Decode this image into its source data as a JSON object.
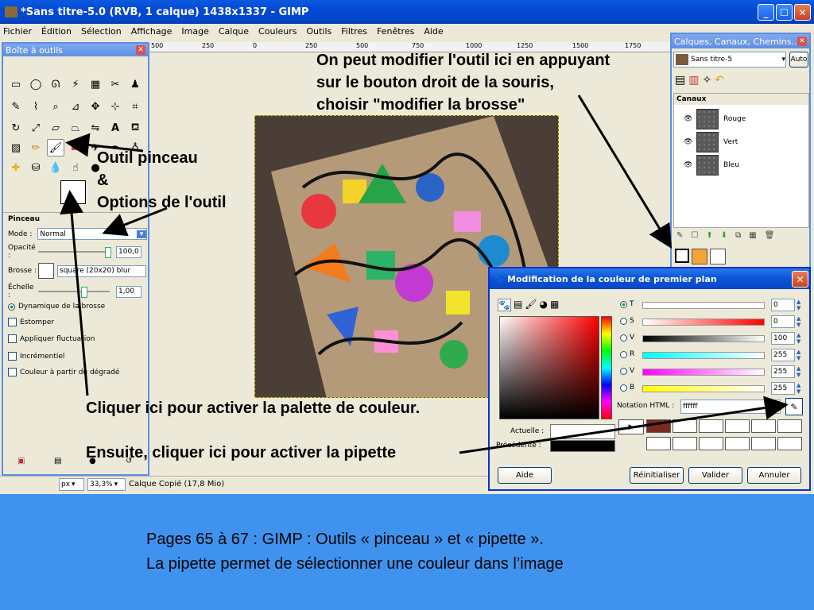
{
  "window": {
    "title": "*Sans titre-5.0 (RVB, 1 calque) 1438x1337 - GIMP"
  },
  "menu": [
    "Fichier",
    "Édition",
    "Sélection",
    "Affichage",
    "Image",
    "Calque",
    "Couleurs",
    "Outils",
    "Filtres",
    "Fenêtres",
    "Aide"
  ],
  "ruler": [
    "500",
    "250",
    "0",
    "250",
    "500",
    "750",
    "1000",
    "1250",
    "1500",
    "1750"
  ],
  "toolbox": {
    "title": "Boîte à outils",
    "options_title": "Pinceau",
    "mode_label": "Mode :",
    "mode_value": "Normal",
    "opacity_label": "Opacité :",
    "opacity_value": "100,0",
    "brush_label": "Brosse :",
    "brush_value": "square (20x20) blur",
    "scale_label": "Échelle :",
    "scale_value": "1,00",
    "checkboxes": [
      "Dynamique de la brosse",
      "Estomper",
      "Appliquer fluctuation",
      "Incrémentiel",
      "Couleur à partir du dégradé"
    ]
  },
  "statusbar": {
    "unit": "px",
    "zoom": "33,3%",
    "info": "Calque Copié (17,8 Mio)"
  },
  "dock": {
    "title": "Calques, Canaux, Chemins...",
    "image_select": "Sans titre-5",
    "auto_button": "Auto",
    "section": "Canaux",
    "channels": [
      "Rouge",
      "Vert",
      "Bleu"
    ]
  },
  "colordlg": {
    "title": "Modification de la couleur de premier plan",
    "channels": [
      {
        "label": "T",
        "value": "0"
      },
      {
        "label": "S",
        "value": "0"
      },
      {
        "label": "V",
        "value": "100"
      },
      {
        "label": "R",
        "value": "255"
      },
      {
        "label": "V",
        "value": "255"
      },
      {
        "label": "B",
        "value": "255"
      }
    ],
    "html_label": "Notation HTML :",
    "html_value": "ffffff",
    "current_label": "Actuelle :",
    "previous_label": "Précédente :",
    "buttons": {
      "help": "Aide",
      "reset": "Réinitialiser",
      "ok": "Valider",
      "cancel": "Annuler"
    }
  },
  "annotations": {
    "top": [
      "On peut modifier l'outil ici en appuyant",
      "sur le bouton droit de la souris,",
      "choisir \"modifier la brosse\""
    ],
    "pinceau": [
      "Outil pinceau",
      "&",
      "Options de l'outil"
    ],
    "palette": "Cliquer ici pour activer la palette de couleur.",
    "pipette": "Ensuite, cliquer ici pour activer la pipette"
  },
  "caption": {
    "line1": "Pages 65 à 67 : GIMP : Outils « pinceau » et « pipette ».",
    "line2": "La pipette permet de sélectionner une couleur dans l’image"
  },
  "colors": {
    "slide_bg": "#3f93ee",
    "xp_title": "#0449d4",
    "selection_border": "#d2c700"
  }
}
